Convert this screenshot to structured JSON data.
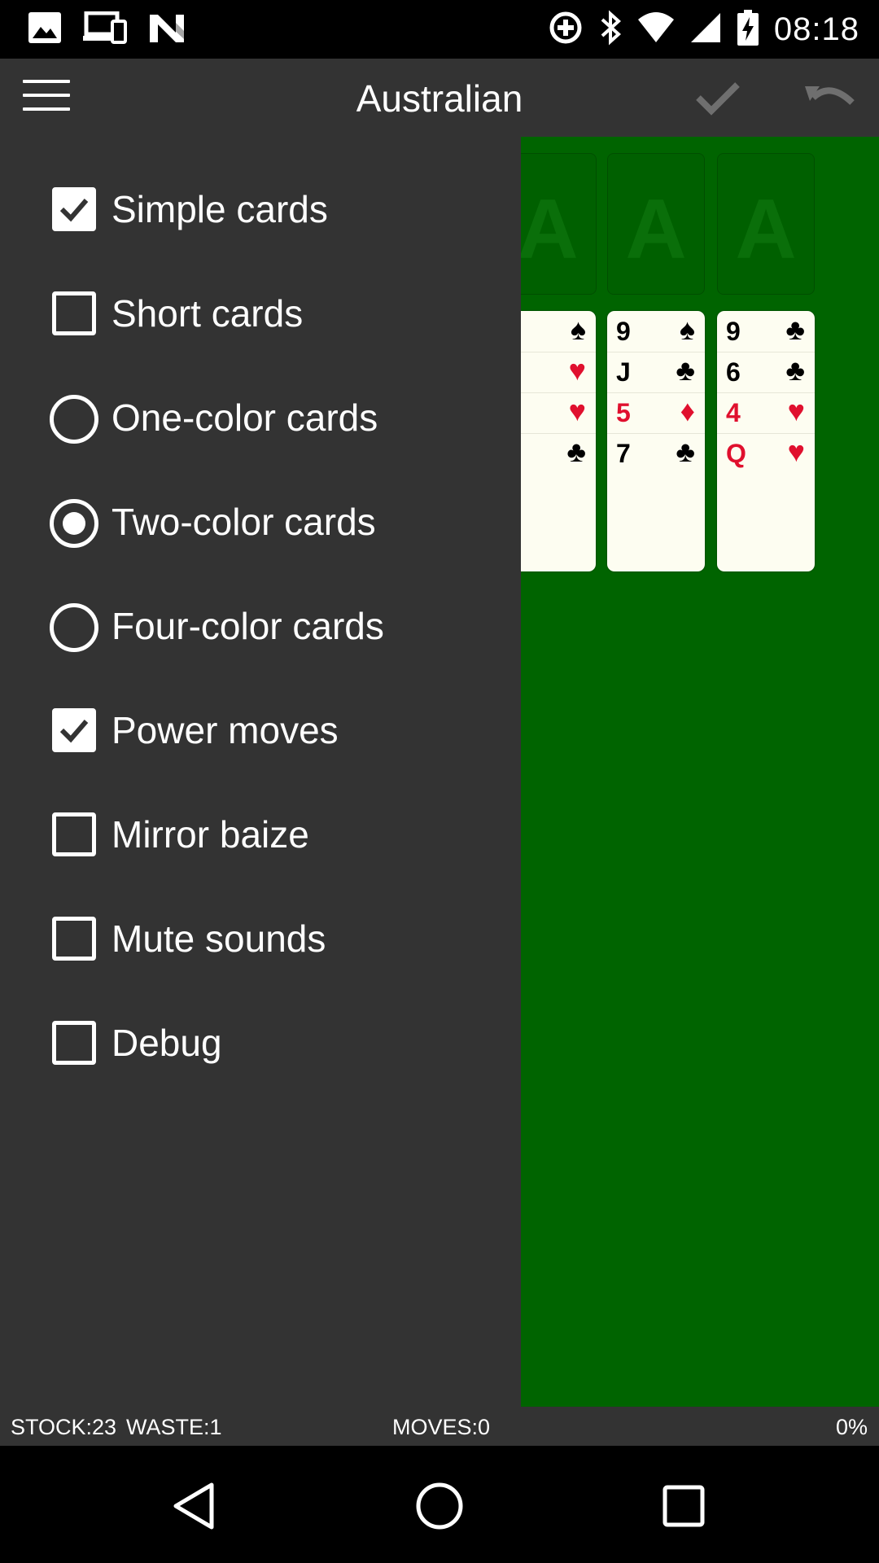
{
  "status_bar": {
    "time": "08:18",
    "left_icons": [
      "image-icon",
      "devices-icon",
      "n-logo-icon"
    ],
    "right_icons": [
      "data-saver-icon",
      "bluetooth-icon",
      "wifi-icon",
      "signal-icon",
      "battery-charging-icon"
    ]
  },
  "toolbar": {
    "title": "Australian",
    "icons": [
      "menu-icon",
      "check-icon",
      "undo-icon"
    ]
  },
  "drawer": {
    "options": [
      {
        "label": "Simple cards",
        "control": "checkbox",
        "checked": true
      },
      {
        "label": "Short cards",
        "control": "checkbox",
        "checked": false
      },
      {
        "label": "One-color cards",
        "control": "radio",
        "checked": false
      },
      {
        "label": "Two-color cards",
        "control": "radio",
        "checked": true
      },
      {
        "label": "Four-color cards",
        "control": "radio",
        "checked": false
      },
      {
        "label": "Power moves",
        "control": "checkbox",
        "checked": true
      },
      {
        "label": "Mirror baize",
        "control": "checkbox",
        "checked": false
      },
      {
        "label": "Mute sounds",
        "control": "checkbox",
        "checked": false
      },
      {
        "label": "Debug",
        "control": "checkbox",
        "checked": false
      }
    ]
  },
  "baize": {
    "color": "#006400",
    "foundations": [
      "A",
      "A",
      "A"
    ],
    "piles": [
      {
        "cards": [
          {
            "rank": "",
            "suit": "♠",
            "color": "#000000"
          },
          {
            "rank": "",
            "suit": "♥",
            "color": "#e0102e"
          },
          {
            "rank": "",
            "suit": "♥",
            "color": "#e0102e"
          },
          {
            "rank": "",
            "suit": "♣",
            "color": "#000000"
          }
        ]
      },
      {
        "cards": [
          {
            "rank": "9",
            "suit": "♠",
            "color": "#000000"
          },
          {
            "rank": "J",
            "suit": "♣",
            "color": "#000000"
          },
          {
            "rank": "5",
            "suit": "♦",
            "color": "#e0102e"
          },
          {
            "rank": "7",
            "suit": "♣",
            "color": "#000000"
          }
        ]
      },
      {
        "cards": [
          {
            "rank": "9",
            "suit": "♣",
            "color": "#000000"
          },
          {
            "rank": "6",
            "suit": "♣",
            "color": "#000000"
          },
          {
            "rank": "4",
            "suit": "♥",
            "color": "#e0102e"
          },
          {
            "rank": "Q",
            "suit": "♥",
            "color": "#e0102e"
          }
        ]
      }
    ]
  },
  "game_status": {
    "stock": "STOCK:23",
    "waste": "WASTE:1",
    "moves": "MOVES:0",
    "percent": "0%"
  },
  "nav_bar": {
    "icons": [
      "back-icon",
      "home-icon",
      "recents-icon"
    ]
  }
}
